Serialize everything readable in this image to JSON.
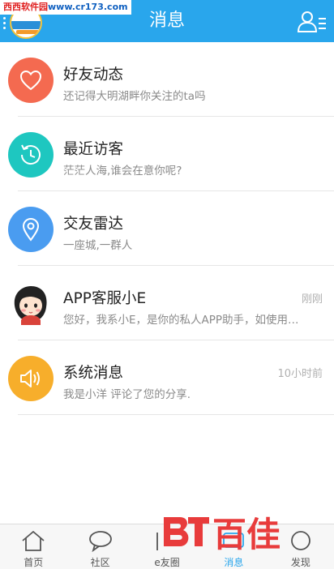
{
  "watermark": {
    "top_red": "西西软件园",
    "top_blue": "www.cr173.com",
    "bottom_text": "百佳"
  },
  "header": {
    "title": "消息"
  },
  "messages": [
    {
      "name": "好友动态",
      "desc": "还记得大明湖畔你关注的ta吗",
      "time": "",
      "icon": "heart-icon",
      "color": "#f46a50"
    },
    {
      "name": "最近访客",
      "desc": "茫茫人海,谁会在意你呢?",
      "time": "",
      "icon": "history-clock-icon",
      "color": "#1ec7c0"
    },
    {
      "name": "交友雷达",
      "desc": "一座城,一群人",
      "time": "",
      "icon": "location-pin-icon",
      "color": "#4a9cf0"
    },
    {
      "name": "APP客服小E",
      "desc": "您好，我系小E，是你的私人APP助手，如使用…",
      "time": "刚刚",
      "icon": "cartoon-girl-avatar",
      "color": "#ffffff"
    },
    {
      "name": "系统消息",
      "desc": "我是小洋 评论了您的分享.",
      "time": "10小时前",
      "icon": "speaker-icon",
      "color": "#f7ae2b"
    }
  ],
  "tabs": [
    {
      "label": "首页",
      "icon": "home-icon"
    },
    {
      "label": "社区",
      "icon": "chat-bubble-icon"
    },
    {
      "label": "e友圈",
      "icon": "friends-icon"
    },
    {
      "label": "消息",
      "icon": "message-icon"
    },
    {
      "label": "发现",
      "icon": "discover-icon"
    }
  ],
  "colors": {
    "header_bg": "#29a6ec",
    "accent": "#29a6ec",
    "divider": "#e6e6e6"
  }
}
